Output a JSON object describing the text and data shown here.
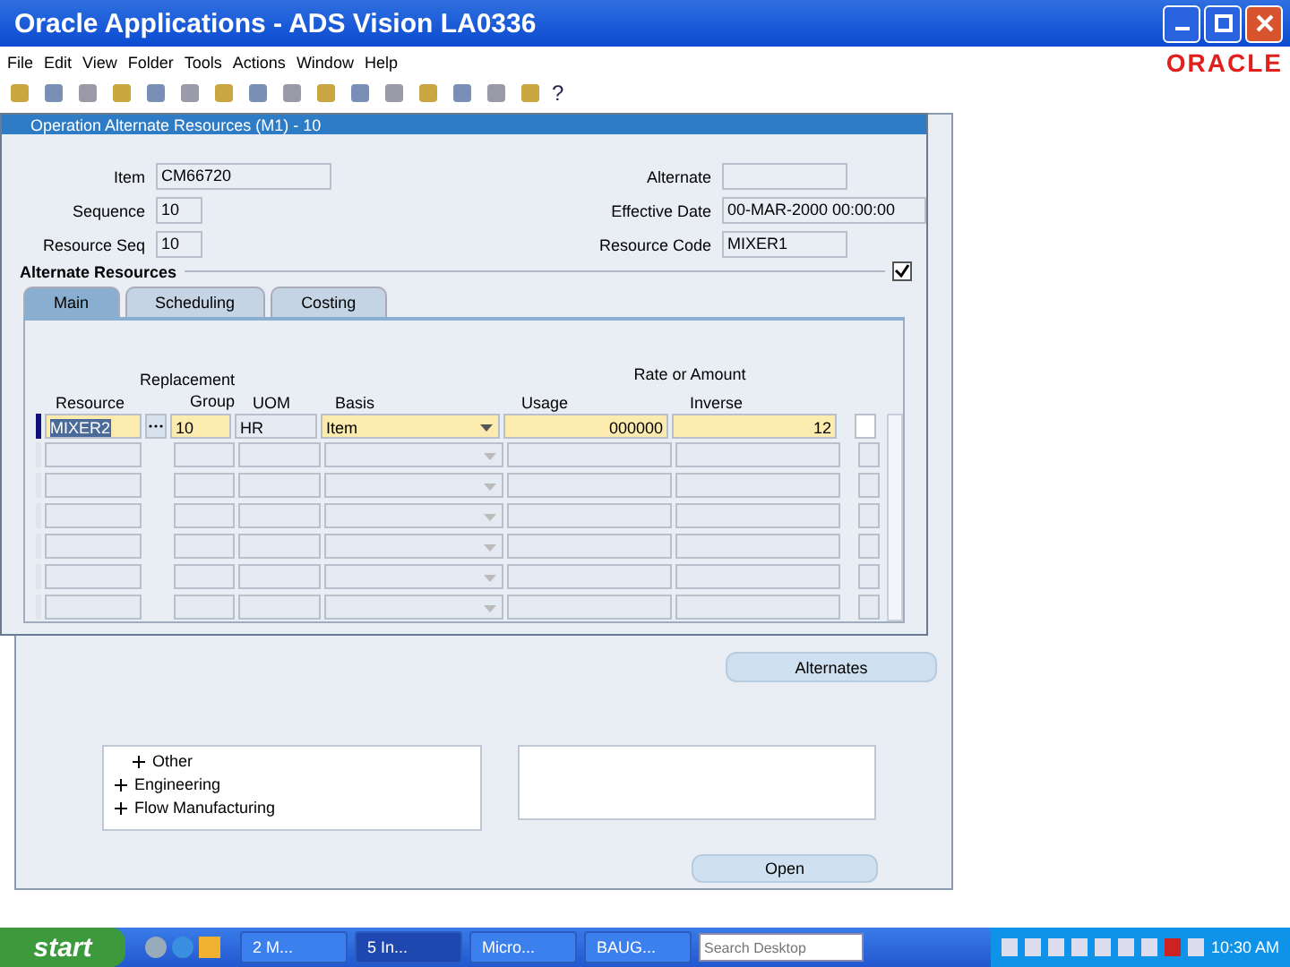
{
  "app_window": {
    "title": "Oracle Applications - ADS Vision LA0336"
  },
  "menu": [
    "File",
    "Edit",
    "View",
    "Folder",
    "Tools",
    "Actions",
    "Window",
    "Help"
  ],
  "brand": "ORACLE",
  "toolbar_help": "?",
  "background_window": {
    "alternates_button": "Alternates",
    "open_button": "Open",
    "tree": [
      {
        "children": [
          {
            "label": "Other",
            "expanded": false
          }
        ]
      },
      {
        "label": "Engineering",
        "expanded": false
      },
      {
        "label": "Flow Manufacturing",
        "expanded": false
      }
    ]
  },
  "dialog": {
    "title": "Operation Alternate Resources (M1) - 10",
    "left_fields": [
      {
        "label": "Item",
        "value": "CM66720"
      },
      {
        "label": "Sequence",
        "value": "10"
      },
      {
        "label": "Resource Seq",
        "value": "10"
      }
    ],
    "right_fields": [
      {
        "label": "Alternate"
      },
      {
        "label": "Effective Date",
        "value": "00-MAR-2000 00:00:00"
      },
      {
        "label": "Resource Code",
        "value": "MIXER1"
      }
    ],
    "section": "Alternate Resources",
    "section_checked": true,
    "tabs": [
      {
        "label": "Main",
        "selected": true
      },
      {
        "label": "Scheduling",
        "selected": false
      },
      {
        "label": "Costing",
        "selected": false
      }
    ],
    "group_header": "Rate or Amount",
    "columns": [
      "Resource",
      "Replacement Group",
      "UOM",
      "Basis",
      "Usage",
      "Inverse"
    ],
    "rows": [
      {
        "selected": true,
        "resource": "MIXER2",
        "group": "10",
        "uom": "HR",
        "basis": "Item",
        "usage": "000000",
        "inverse": "12",
        "checked": false
      }
    ]
  },
  "taskbar": {
    "start": "start",
    "tasks": [
      {
        "label": "2 M...",
        "active": false
      },
      {
        "label": "5 In...",
        "active": true
      },
      {
        "label": "Micro...",
        "active": false
      },
      {
        "label": "BAUG...",
        "active": false
      }
    ],
    "search": {
      "placeholder": "Search Desktop"
    },
    "clock": "10:30 AM"
  }
}
